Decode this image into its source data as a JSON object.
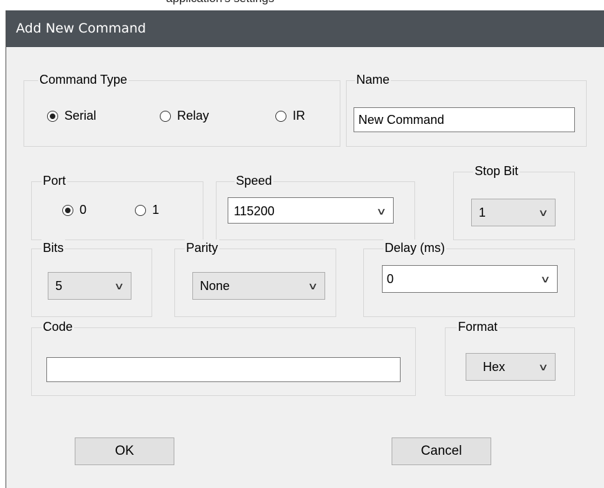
{
  "above_text": "application's settings",
  "dialog": {
    "title": "Add New Command"
  },
  "command_type": {
    "label": "Command Type",
    "options": [
      "Serial",
      "Relay",
      "IR"
    ],
    "selected": "Serial"
  },
  "name": {
    "label": "Name",
    "value": "New Command"
  },
  "port": {
    "label": "Port",
    "options": [
      "0",
      "1"
    ],
    "selected": "0"
  },
  "speed": {
    "label": "Speed",
    "value": "115200"
  },
  "stop_bit": {
    "label": "Stop Bit",
    "value": "1"
  },
  "bits": {
    "label": "Bits",
    "value": "5"
  },
  "parity": {
    "label": "Parity",
    "value": "None"
  },
  "delay": {
    "label": "Delay (ms)",
    "value": "0"
  },
  "code": {
    "label": "Code",
    "value": ""
  },
  "format": {
    "label": "Format",
    "value": "Hex"
  },
  "buttons": {
    "ok": "OK",
    "cancel": "Cancel"
  },
  "icons": {
    "dropdown": "chevron-down-icon",
    "radio": "radio-circle-icon"
  },
  "colors": {
    "titlebar": "#4c5258",
    "dialog_bg": "#f0f0f0",
    "button_bg": "#e1e1e1"
  }
}
